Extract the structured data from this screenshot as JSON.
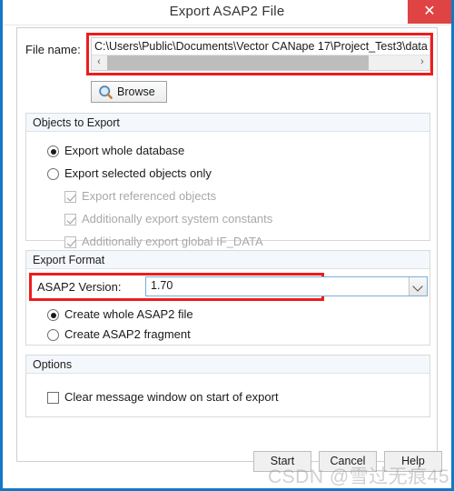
{
  "window": {
    "title": "Export ASAP2 File",
    "close_icon": "close-icon",
    "close_glyph": "✕",
    "accent_color": "#1278c8",
    "close_color": "#e04343"
  },
  "file": {
    "label": "File name:",
    "value": "C:\\Users\\Public\\Documents\\Vector CANape 17\\Project_Test3\\data",
    "scroll_left_glyph": "‹",
    "scroll_right_glyph": "›",
    "highlight_color": "#ee1c1c"
  },
  "browse": {
    "label": "Browse",
    "icon": "magnifier-icon"
  },
  "objects_group": {
    "title": "Objects to Export",
    "options": [
      {
        "type": "radio",
        "label": "Export whole database",
        "checked": true,
        "disabled": false
      },
      {
        "type": "radio",
        "label": "Export selected objects only",
        "checked": false,
        "disabled": false
      },
      {
        "type": "checkbox",
        "label": "Export referenced objects",
        "checked": true,
        "disabled": true
      },
      {
        "type": "checkbox",
        "label": "Additionally export system constants",
        "checked": true,
        "disabled": true
      },
      {
        "type": "checkbox",
        "label": "Additionally export global IF_DATA",
        "checked": true,
        "disabled": true
      }
    ]
  },
  "format_group": {
    "title": "Export Format",
    "version_label": "ASAP2 Version:",
    "version_value": "1.70",
    "version_options": [
      "1.70"
    ],
    "options": [
      {
        "type": "radio",
        "label": "Create whole ASAP2 file",
        "checked": true,
        "disabled": false
      },
      {
        "type": "radio",
        "label": "Create ASAP2 fragment",
        "checked": false,
        "disabled": false
      }
    ]
  },
  "options_group": {
    "title": "Options",
    "options": [
      {
        "type": "checkbox",
        "label": "Clear message window on start of export",
        "checked": false,
        "disabled": false
      }
    ]
  },
  "buttons": {
    "start": "Start",
    "cancel": "Cancel",
    "help": "Help"
  },
  "watermark": {
    "text": "CSDN @雪过无痕45"
  }
}
